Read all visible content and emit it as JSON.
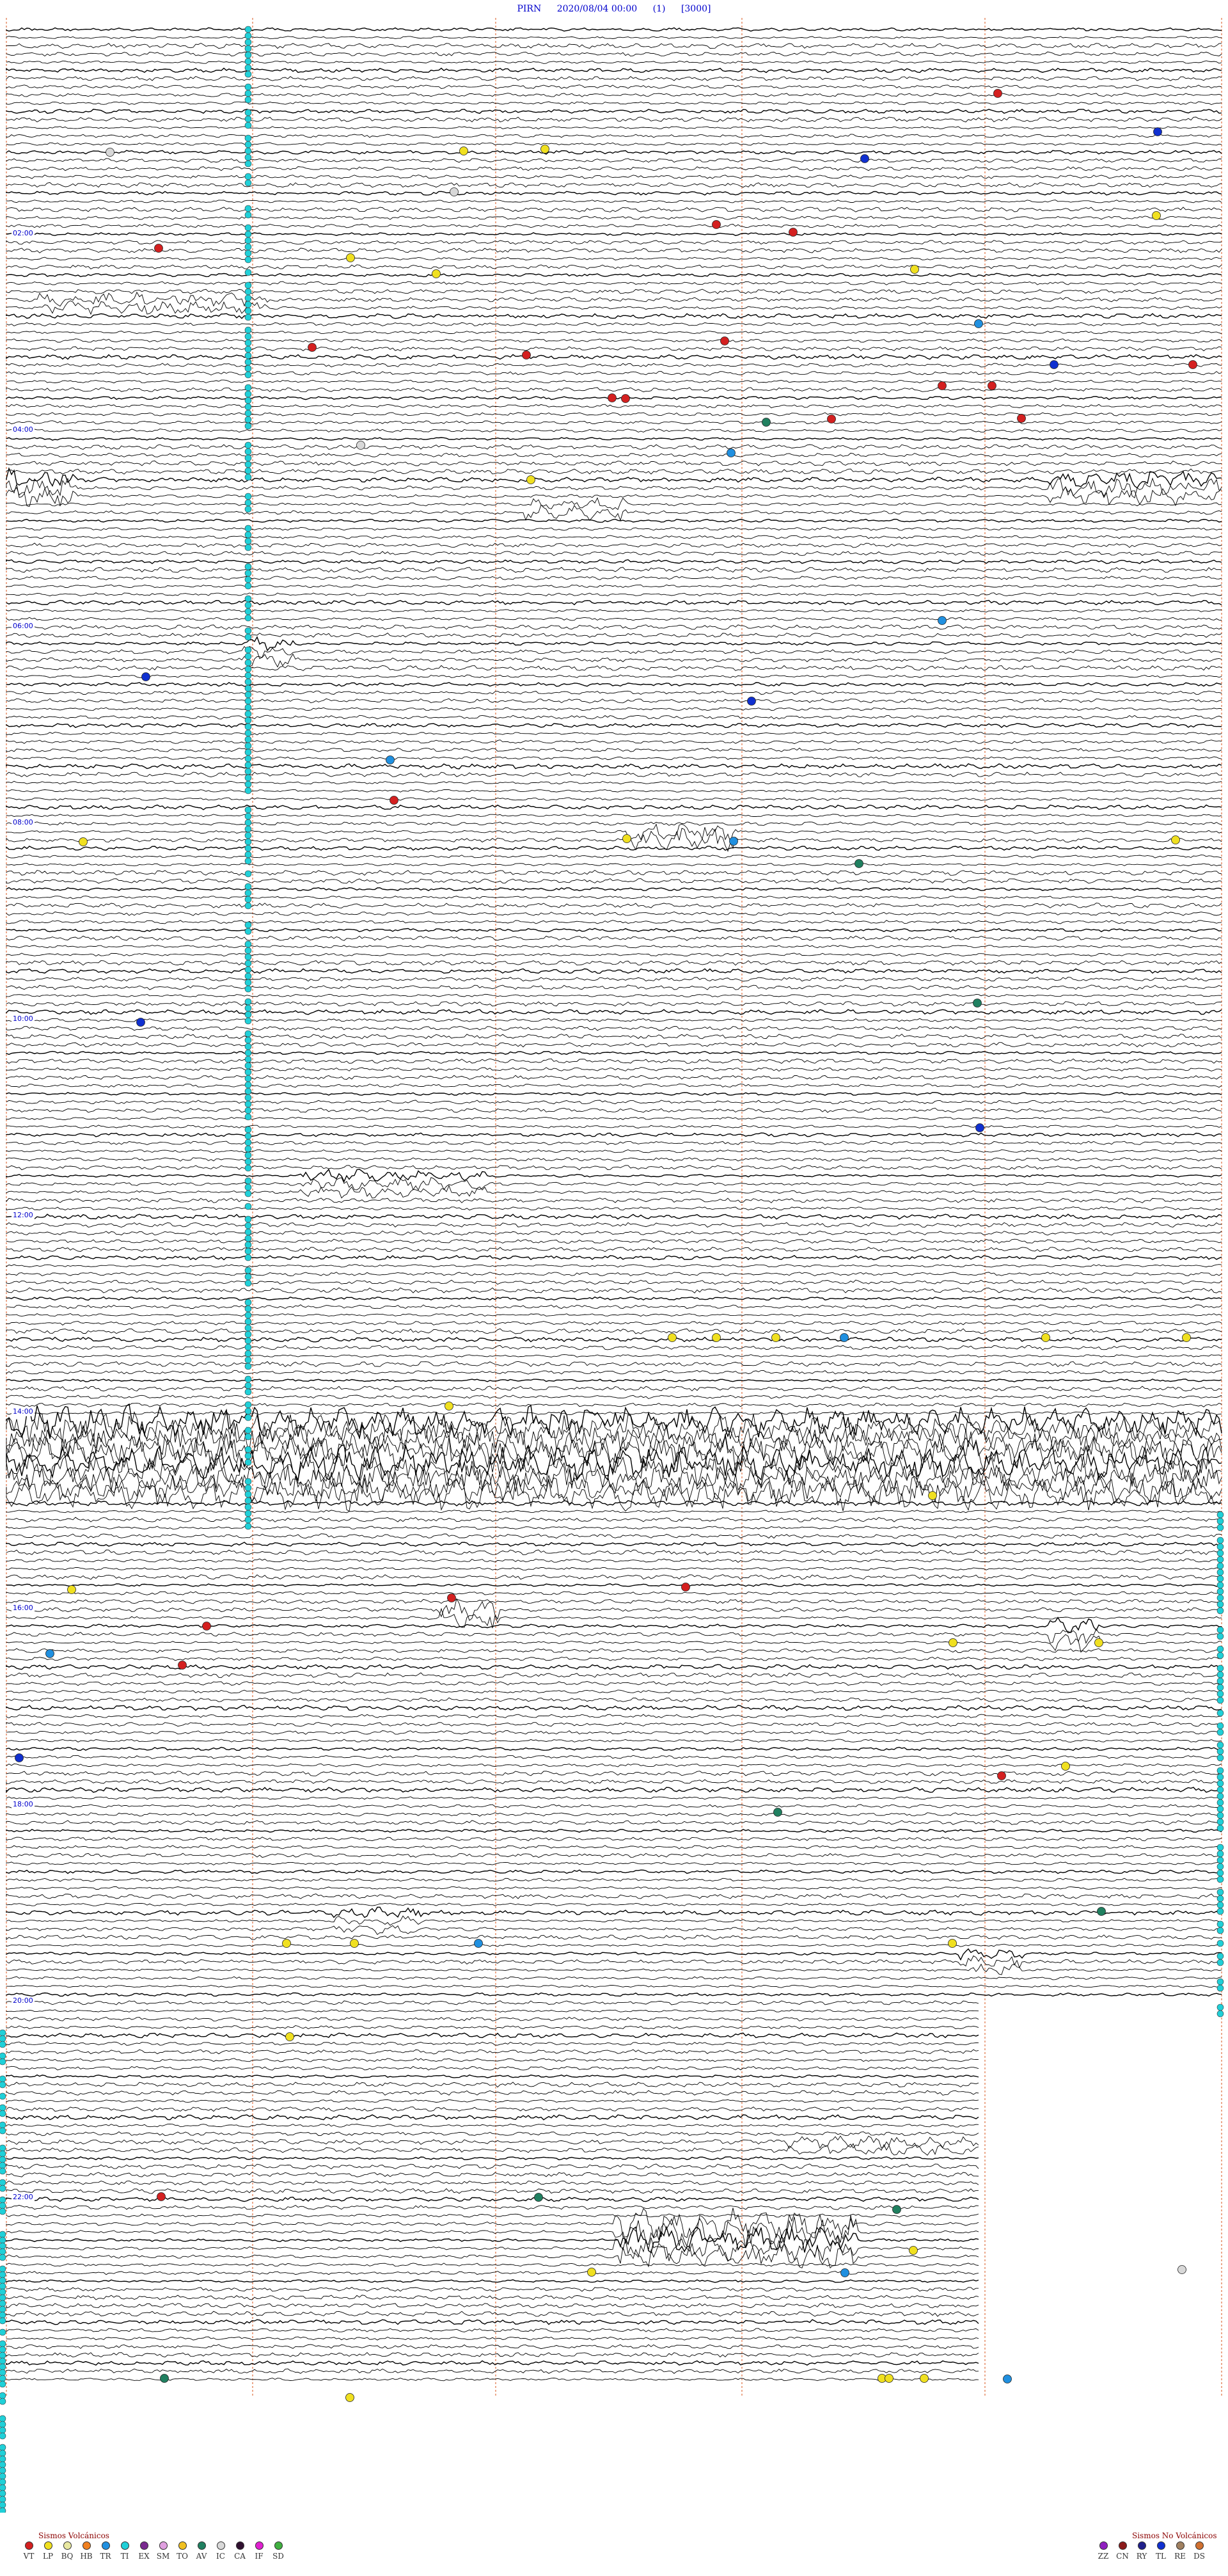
{
  "header": {
    "station": "PIRN",
    "datetime": "2020/08/04 00:00",
    "channel": "(1)",
    "scale": "[3000]"
  },
  "drum": {
    "trace_color": "#000000",
    "hour_line_color": "#e07040",
    "marker_color": "#20d0d8",
    "hour_labels": [
      "02:00",
      "04:00",
      "06:00",
      "08:00",
      "10:00",
      "12:00",
      "14:00",
      "16:00",
      "18:00",
      "20:00",
      "22:00"
    ]
  },
  "event_colors": {
    "VT": "#d42020",
    "LP": "#f0e020",
    "BQ": "#e8e8a0",
    "HB": "#f08020",
    "TR": "#2090e0",
    "TI": "#20d0d8",
    "EX": "#7a2a90",
    "SM": "#e0a0e0",
    "TO": "#f0c020",
    "AV": "#208060",
    "IC": "#d8d8d8",
    "CA": "#301030",
    "IF": "#e020d0",
    "SD": "#40b040",
    "ZZ": "#9020c0",
    "CN": "#8b1a1a",
    "RY": "#20208b",
    "TL": "#1030d0",
    "RE": "#a08060",
    "DS": "#d07030"
  },
  "legend_volcanic": {
    "title": "Sismos Volcánicos",
    "items": [
      "VT",
      "LP",
      "BQ",
      "HB",
      "TR",
      "TI",
      "EX",
      "SM",
      "TO",
      "AV",
      "IC",
      "CA",
      "IF",
      "SD"
    ]
  },
  "legend_nonvolcanic": {
    "title": "Sismos No Volcánicos",
    "items": [
      "ZZ",
      "CN",
      "RY",
      "TL",
      "RE",
      "DS"
    ]
  }
}
